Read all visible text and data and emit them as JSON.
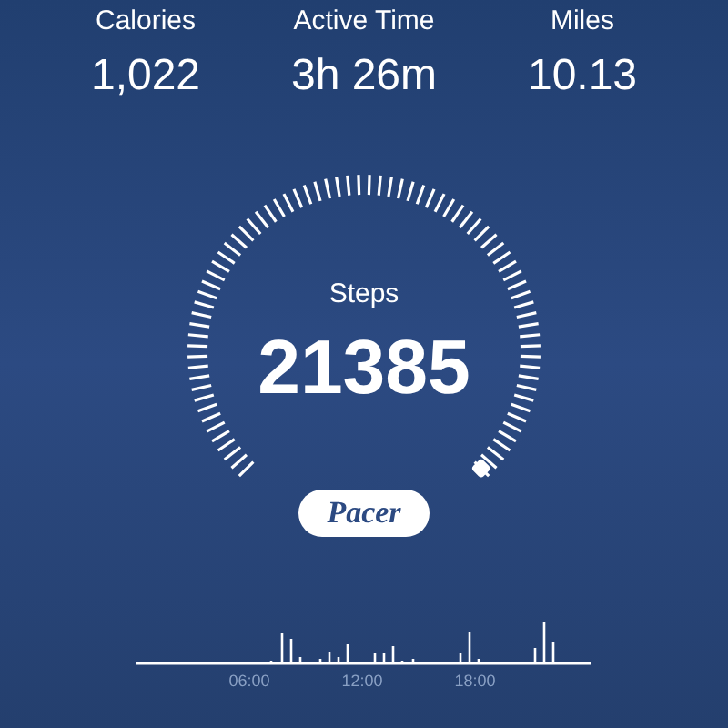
{
  "stats": [
    {
      "label": "Calories",
      "value": "1,022"
    },
    {
      "label": "Active Time",
      "value": "3h 26m"
    },
    {
      "label": "Miles",
      "value": "10.13"
    }
  ],
  "gauge": {
    "label": "Steps",
    "value": "21385"
  },
  "logo": "Pacer",
  "activity_chart": {
    "time_labels": [
      "06:00",
      "12:00",
      "18:00"
    ]
  }
}
